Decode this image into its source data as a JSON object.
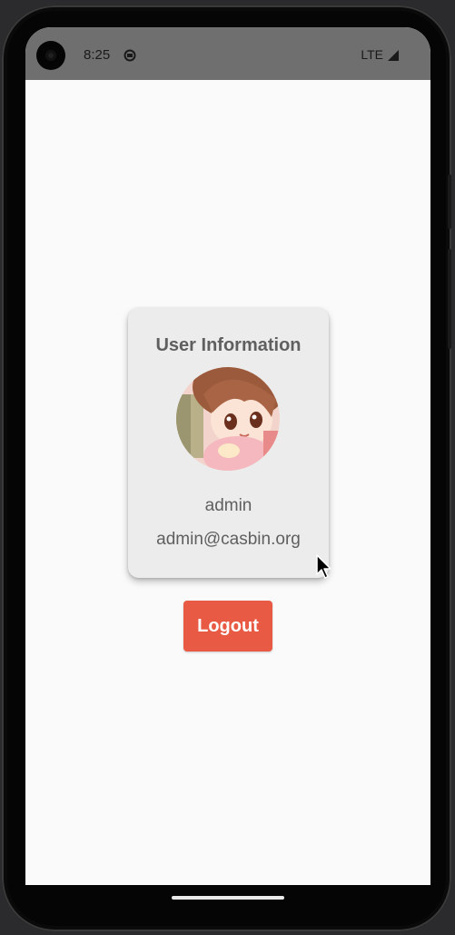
{
  "status_bar": {
    "time": "8:25",
    "network": "LTE",
    "icons": [
      "camera-icon",
      "notification-icon",
      "signal-icon"
    ]
  },
  "user_card": {
    "title": "User Information",
    "avatar": "anime-avatar",
    "username": "admin",
    "email": "admin@casbin.org"
  },
  "actions": {
    "logout_label": "Logout"
  },
  "colors": {
    "accent": "#e85a43",
    "card_background": "#ececec",
    "text": "#5f5f5f",
    "status_bar": "#6f6f6f"
  }
}
